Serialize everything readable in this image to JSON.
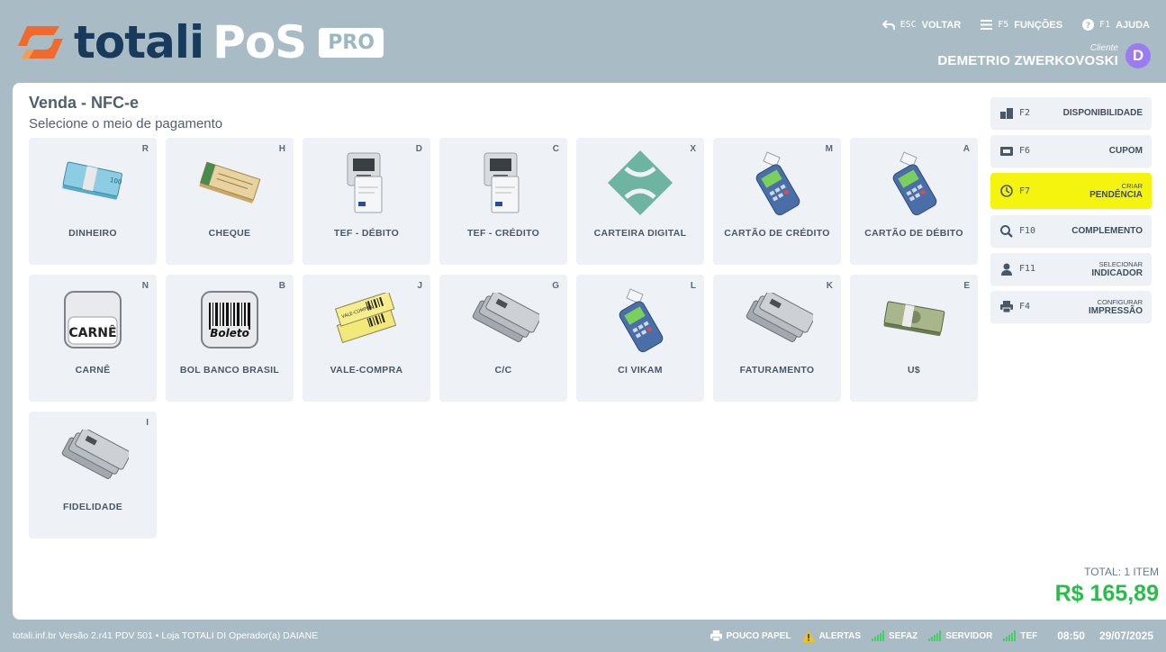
{
  "header": {
    "logo_word1": "totali",
    "logo_word2": "PoS",
    "logo_badge": "PRO",
    "nav": [
      {
        "key": "ESC",
        "label": "VOLTAR",
        "icon": "back-arrow-icon"
      },
      {
        "key": "F5",
        "label": "FUNÇÕES",
        "icon": "menu-icon"
      },
      {
        "key": "F1",
        "label": "AJUDA",
        "icon": "help-icon"
      }
    ],
    "client_label": "Cliente",
    "client_name": "DEMETRIO ZWERKOVOSKI",
    "avatar_letter": "D"
  },
  "main": {
    "title": "Venda - NFC-e",
    "subtitle": "Selecione o meio de pagamento",
    "payment_methods": [
      {
        "key": "R",
        "label": "DINHEIRO",
        "icon": "cash-icon"
      },
      {
        "key": "H",
        "label": "CHEQUE",
        "icon": "cheque-icon"
      },
      {
        "key": "D",
        "label": "TEF - DÉBITO",
        "icon": "atm-card-icon"
      },
      {
        "key": "C",
        "label": "TEF - CRÉDITO",
        "icon": "atm-card-icon"
      },
      {
        "key": "X",
        "label": "CARTEIRA DIGITAL",
        "icon": "pix-icon"
      },
      {
        "key": "M",
        "label": "CARTÃO DE CRÉDITO",
        "icon": "card-terminal-icon"
      },
      {
        "key": "A",
        "label": "CARTÃO DE DÉBITO",
        "icon": "card-terminal-icon"
      },
      {
        "key": "N",
        "label": "CARNÊ",
        "icon": "carne-icon",
        "icon_text": "CARNÊ"
      },
      {
        "key": "B",
        "label": "BOL BANCO BRASIL",
        "icon": "boleto-icon",
        "icon_text": "Boleto"
      },
      {
        "key": "J",
        "label": "VALE-COMPRA",
        "icon": "voucher-icon",
        "icon_text": "VALE-COMPRA"
      },
      {
        "key": "G",
        "label": "C/C",
        "icon": "cards-stack-icon"
      },
      {
        "key": "L",
        "label": "CI VIKAM",
        "icon": "card-terminal-icon"
      },
      {
        "key": "K",
        "label": "FATURAMENTO",
        "icon": "cards-stack-icon"
      },
      {
        "key": "E",
        "label": "U$",
        "icon": "dollar-bills-icon"
      },
      {
        "key": "I",
        "label": "FIDELIDADE",
        "icon": "cards-stack-icon"
      }
    ],
    "total_label": "TOTAL: 1 ITEM",
    "total_value": "R$ 165,89"
  },
  "actions": [
    {
      "key": "F2",
      "small": "",
      "label": "DISPONIBILIDADE",
      "icon": "boxes-icon",
      "highlight": false
    },
    {
      "key": "F6",
      "small": "",
      "label": "CUPOM",
      "icon": "ticket-icon",
      "highlight": false
    },
    {
      "key": "F7",
      "small": "CRIAR",
      "label": "PENDÊNCIA",
      "icon": "clock-icon",
      "highlight": true
    },
    {
      "key": "F10",
      "small": "",
      "label": "COMPLEMENTO",
      "icon": "search-icon",
      "highlight": false
    },
    {
      "key": "F11",
      "small": "SELECIONAR",
      "label": "INDICADOR",
      "icon": "user-icon",
      "highlight": false
    },
    {
      "key": "F4",
      "small": "CONFIGURAR",
      "label": "IMPRESSÃO",
      "icon": "printer-icon",
      "highlight": false
    }
  ],
  "footer": {
    "info": "totali.inf.br Versão 2.r41 PDV 501  •  Loja TOTALI DI Operador(a) DAIANE",
    "status": [
      {
        "label": "POUCO PAPEL",
        "icon": "printer-icon"
      },
      {
        "label": "ALERTAS",
        "icon": "warning-icon"
      },
      {
        "label": "SEFAZ",
        "icon": "signal-icon"
      },
      {
        "label": "SERVIDOR",
        "icon": "signal-icon"
      },
      {
        "label": "TEF",
        "icon": "signal-icon"
      }
    ],
    "time": "08:50",
    "date": "29/07/2025"
  },
  "colors": {
    "background": "#a9bcc6",
    "logo_orange": "#f06a2d",
    "logo_navy": "#183b5d",
    "highlight": "#f4f40e",
    "total_green": "#2bbb4a",
    "avatar": "#9b7cf0",
    "signal_green": "#3fd35d"
  }
}
